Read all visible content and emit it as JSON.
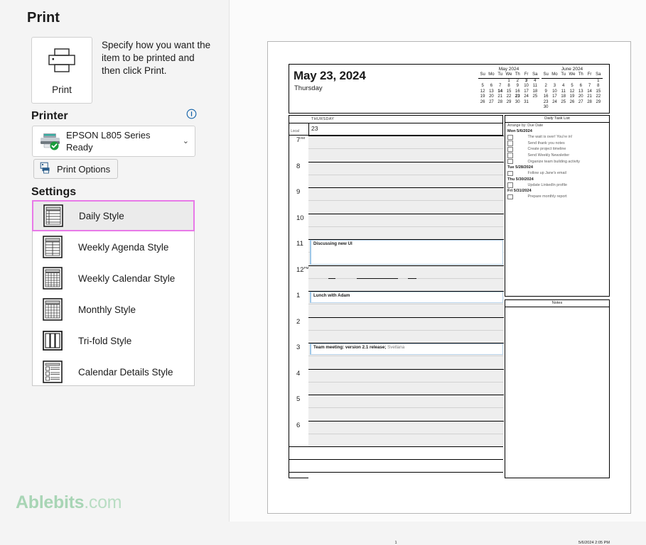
{
  "page": {
    "title": "Print"
  },
  "print_button": {
    "label": "Print",
    "icon": "printer-icon"
  },
  "print_description": "Specify how you want the item to be printed and then click Print.",
  "printer": {
    "heading": "Printer",
    "info_icon": "info-icon",
    "name": "EPSON L805 Series",
    "status": "Ready",
    "chevron": "⌄",
    "print_options_label": "Print Options"
  },
  "settings": {
    "heading": "Settings",
    "styles": [
      {
        "label": "Daily Style",
        "icon": "daily-style-icon",
        "selected": true
      },
      {
        "label": "Weekly Agenda Style",
        "icon": "weekly-agenda-style-icon",
        "selected": false
      },
      {
        "label": "Weekly Calendar Style",
        "icon": "weekly-calendar-style-icon",
        "selected": false
      },
      {
        "label": "Monthly Style",
        "icon": "monthly-style-icon",
        "selected": false
      },
      {
        "label": "Tri-fold Style",
        "icon": "tri-fold-style-icon",
        "selected": false
      },
      {
        "label": "Calendar Details Style",
        "icon": "calendar-details-style-icon",
        "selected": false
      }
    ],
    "selected_highlight_color": "#e879e8"
  },
  "watermark": {
    "brand": "Ablebits",
    "tld": ".com"
  },
  "preview": {
    "header": {
      "date": "May 23, 2024",
      "weekday": "Thursday"
    },
    "mini_calendars": [
      {
        "title": "May 2024",
        "dow": [
          "Su",
          "Mo",
          "Tu",
          "We",
          "Th",
          "Fr",
          "Sa"
        ],
        "weeks": [
          [
            "",
            "",
            "",
            "",
            "1",
            "2",
            "3",
            "4"
          ],
          [
            "5",
            "6",
            "7",
            "8",
            "9",
            "10",
            "11"
          ],
          [
            "12",
            "13",
            "14",
            "15",
            "16",
            "17",
            "18"
          ],
          [
            "19",
            "20",
            "21",
            "22",
            "23",
            "24",
            "25"
          ],
          [
            "26",
            "27",
            "28",
            "29",
            "30",
            "31",
            ""
          ]
        ],
        "bold_days": [
          "3",
          "14",
          "23"
        ]
      },
      {
        "title": "June 2024",
        "dow": [
          "Su",
          "Mo",
          "Tu",
          "We",
          "Th",
          "Fr",
          "Sa"
        ],
        "weeks": [
          [
            "",
            "",
            "",
            "",
            "",
            "",
            "1"
          ],
          [
            "2",
            "3",
            "4",
            "5",
            "6",
            "7",
            "8"
          ],
          [
            "9",
            "10",
            "11",
            "12",
            "13",
            "14",
            "15"
          ],
          [
            "16",
            "17",
            "18",
            "19",
            "20",
            "21",
            "22"
          ],
          [
            "23",
            "24",
            "25",
            "26",
            "27",
            "28",
            "29"
          ],
          [
            "30",
            "",
            "",
            "",
            "",
            "",
            ""
          ]
        ],
        "bold_days": []
      }
    ],
    "schedule": {
      "day_name": "THURSDAY",
      "day_number": "23",
      "timezone_label": "Local",
      "hours": [
        {
          "label": "7",
          "meridiem": "AM"
        },
        {
          "label": "8",
          "meridiem": ""
        },
        {
          "label": "9",
          "meridiem": ""
        },
        {
          "label": "10",
          "meridiem": ""
        },
        {
          "label": "11",
          "meridiem": ""
        },
        {
          "label": "12",
          "meridiem": "PM"
        },
        {
          "label": "1",
          "meridiem": ""
        },
        {
          "label": "2",
          "meridiem": ""
        },
        {
          "label": "3",
          "meridiem": ""
        },
        {
          "label": "4",
          "meridiem": ""
        },
        {
          "label": "5",
          "meridiem": ""
        },
        {
          "label": "6",
          "meridiem": ""
        }
      ],
      "events": [
        {
          "title": "Discussing new UI",
          "extra": "",
          "hour_index": 4,
          "half": 0,
          "span_halves": 2
        },
        {
          "title": "Lunch with Adam",
          "extra": "",
          "hour_index": 6,
          "half": 0,
          "span_halves": 1
        },
        {
          "title": "Team meeting: version 2.1 release;",
          "extra": " Svetlana",
          "hour_index": 8,
          "half": 0,
          "span_halves": 1
        }
      ]
    },
    "task_list": {
      "heading": "Daily Task List",
      "arrange_by": "Arrange by: Due Date",
      "groups": [
        {
          "date": "Mon 5/6/2024",
          "tasks": [
            "The wait is over! You're in!",
            "Send thank you notes",
            "Create project timeline",
            "Send Weekly Newsletter",
            "Organize team building activity"
          ]
        },
        {
          "date": "Tue 5/28/2024",
          "tasks": [
            "Follow up Jane's email"
          ]
        },
        {
          "date": "Thu 5/30/2024",
          "tasks": [
            "Update LinkedIn profile"
          ]
        },
        {
          "date": "Fri 5/31/2024",
          "tasks": [
            "Prepare monthly report"
          ]
        }
      ]
    },
    "notes": {
      "heading": "Notes"
    },
    "footer": {
      "page_number": "1",
      "timestamp": "5/6/2024 2:05 PM"
    }
  }
}
